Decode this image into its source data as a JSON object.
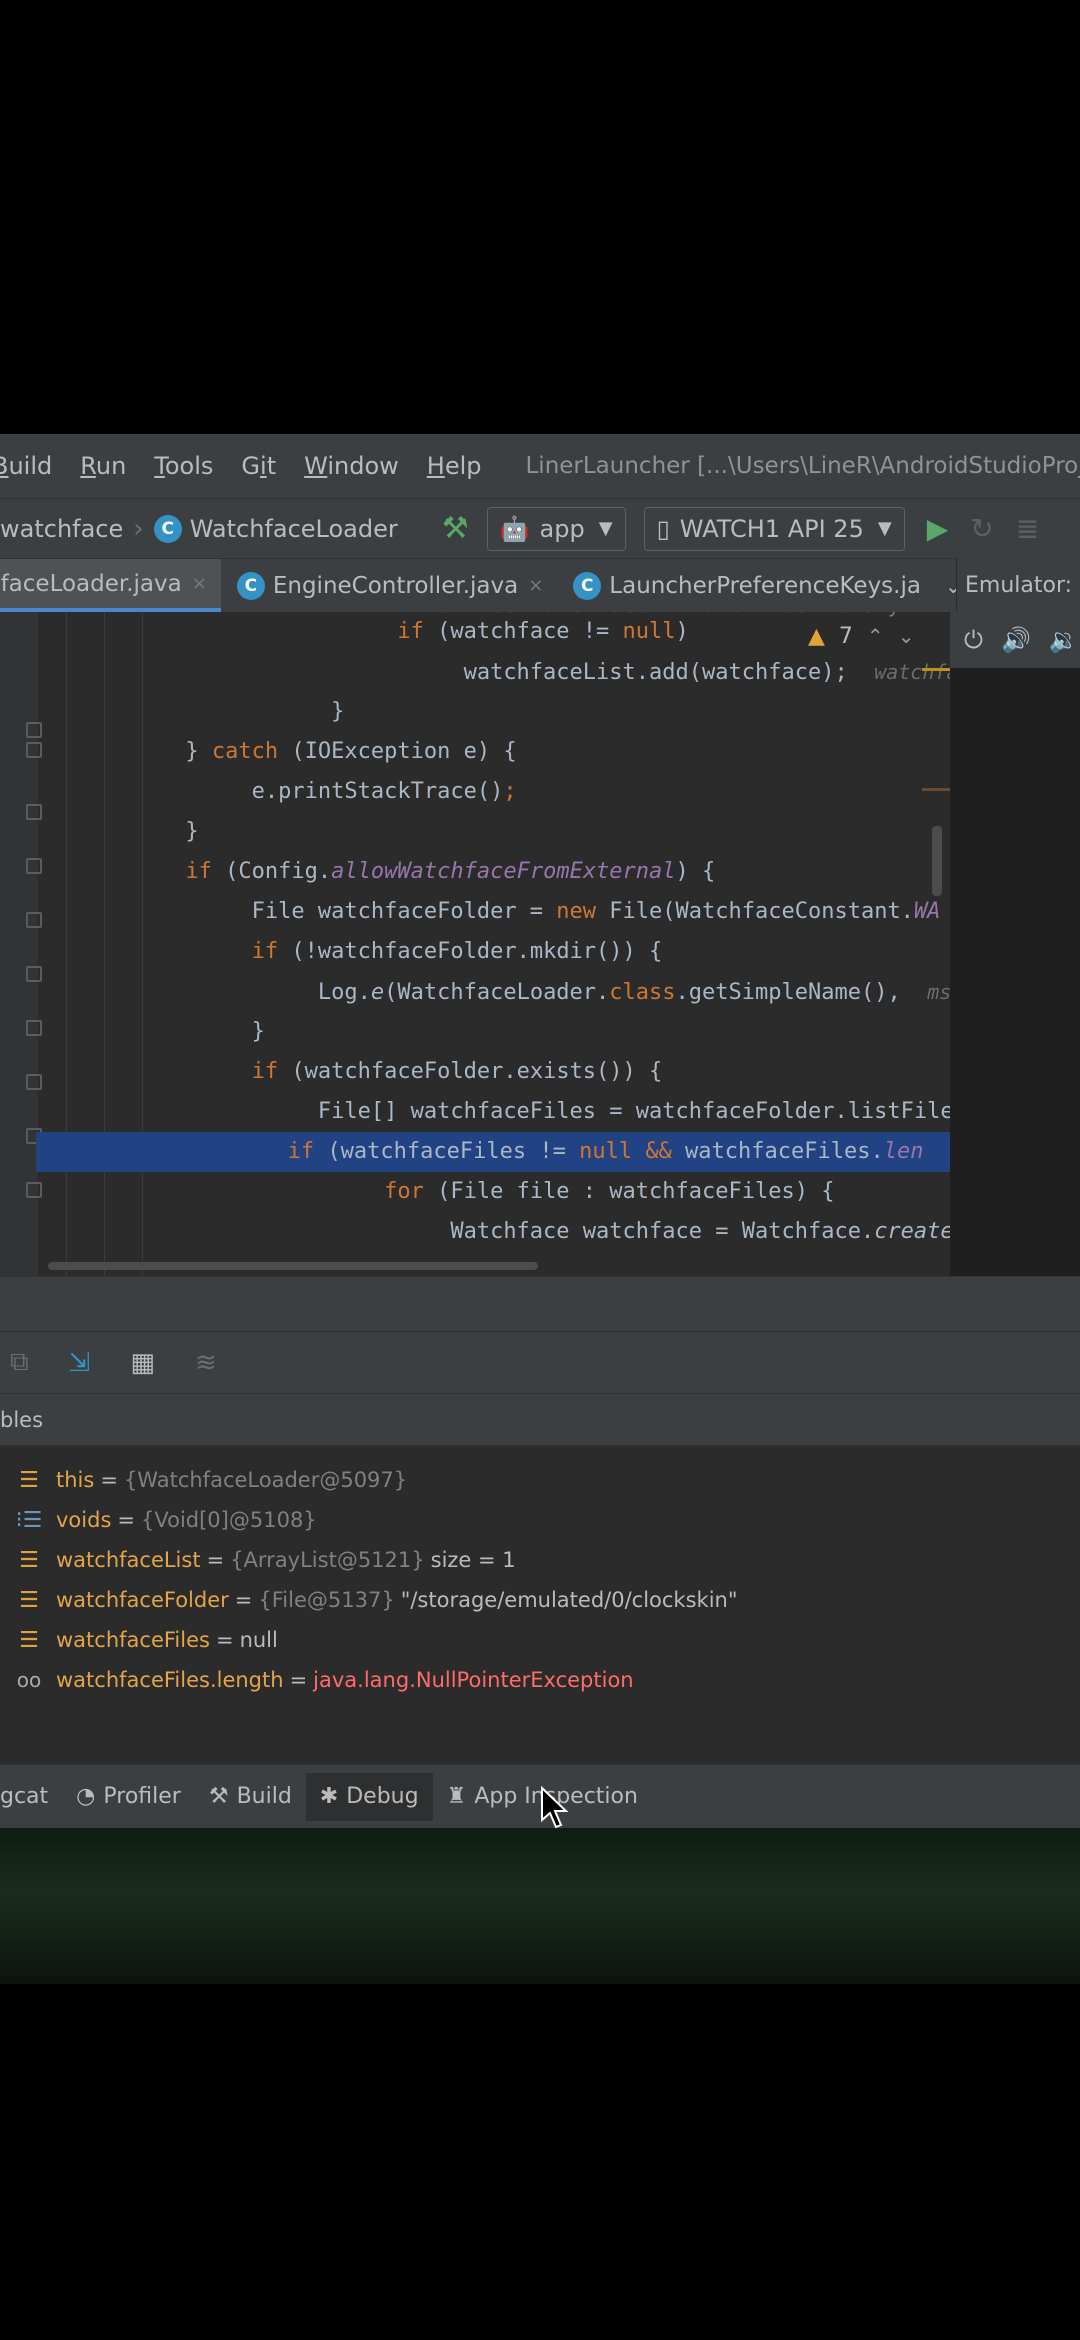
{
  "menu": {
    "items": [
      {
        "prefix": "",
        "mnemonic": "B",
        "rest": "uild"
      },
      {
        "prefix": "",
        "mnemonic": "R",
        "rest": "un"
      },
      {
        "prefix": "",
        "mnemonic": "T",
        "rest": "ools"
      },
      {
        "prefix": "G",
        "mnemonic": "i",
        "rest": "t"
      },
      {
        "prefix": "",
        "mnemonic": "W",
        "rest": "indow"
      },
      {
        "prefix": "",
        "mnemonic": "H",
        "rest": "elp"
      }
    ],
    "window_title": "LinerLauncher [...\\Users\\LineR\\AndroidStudioProjects\\Li"
  },
  "navbar": {
    "crumb_package": "watchface",
    "crumb_class": "WatchfaceLoader",
    "config": "app",
    "device": "WATCH1 API 25"
  },
  "tabs": [
    {
      "label": "hfaceLoader.java",
      "close": "×"
    },
    {
      "label": "EngineController.java",
      "close": "×"
    },
    {
      "label": "LauncherPreferenceKeys.ja"
    }
  ],
  "emulator_label": "Emulator:",
  "editor": {
    "warning_count": "7",
    "hint_watchface": "watchface",
    "hint_msg": "ms"
  },
  "variables": {
    "header": "bles",
    "rows": [
      {
        "name": "this",
        "type": "{WatchfaceLoader@5097}",
        "value": ""
      },
      {
        "name": "voids",
        "type": "{Void[0]@5108}",
        "value": ""
      },
      {
        "name": "watchfaceList",
        "type": "{ArrayList@5121}",
        "value": "size = 1"
      },
      {
        "name": "watchfaceFolder",
        "type": "{File@5137}",
        "value": "\"/storage/emulated/0/clockskin\""
      },
      {
        "name": "watchfaceFiles",
        "type": "",
        "value": "null"
      },
      {
        "name": "watchfaceFiles.length",
        "type": "",
        "value": "",
        "error": "java.lang.NullPointerException"
      }
    ]
  },
  "bottom_tabs": [
    {
      "label": "gcat"
    },
    {
      "label": "Profiler"
    },
    {
      "label": "Build"
    },
    {
      "label": "Debug"
    },
    {
      "label": "App Inspection"
    }
  ],
  "colors": {
    "selection": "#214283",
    "keyword": "#cc7832",
    "variable_name": "#e3a44a",
    "error": "#ff6b68"
  }
}
